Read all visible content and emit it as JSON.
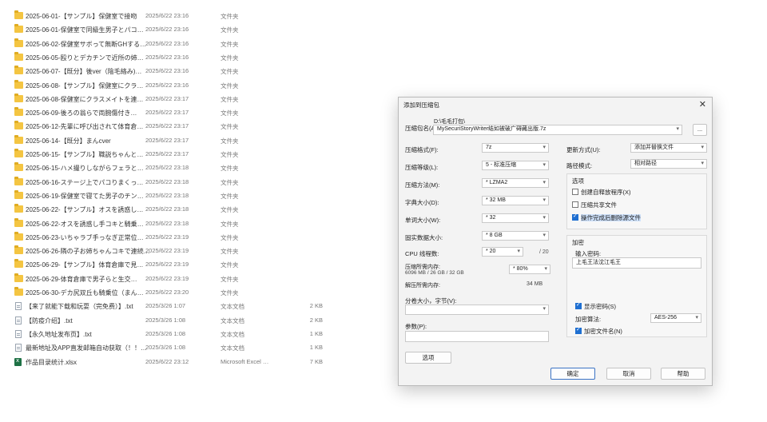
{
  "files": [
    {
      "name": "2025-06-01-【サンプル】保健室で接吻",
      "date": "2025/6/22 23:16",
      "type": "文件夹",
      "size": "",
      "icon": "folder-icon"
    },
    {
      "name": "2025-06-01-保健室で同級生男子とパコ…",
      "date": "2025/6/22 23:16",
      "type": "文件夹",
      "size": "",
      "icon": "folder-icon"
    },
    {
      "name": "2025-06-02-保健室サボって無断GHする…",
      "date": "2025/6/22 23:16",
      "type": "文件夹",
      "size": "",
      "icon": "folder-icon"
    },
    {
      "name": "2025-06-05-殴りとデカチンで近所の姉…",
      "date": "2025/6/22 23:16",
      "type": "文件夹",
      "size": "",
      "icon": "folder-icon"
    },
    {
      "name": "2025-06-07-【既分】後ver（陰毛絡み)…",
      "date": "2025/6/22 23:16",
      "type": "文件夹",
      "size": "",
      "icon": "folder-icon"
    },
    {
      "name": "2025-06-08-【サンプル】保健室にクラ…",
      "date": "2025/6/22 23:16",
      "type": "文件夹",
      "size": "",
      "icon": "folder-icon"
    },
    {
      "name": "2025-06-08-保健室にクラスメイトを連…",
      "date": "2025/6/22 23:17",
      "type": "文件夹",
      "size": "",
      "icon": "folder-icon"
    },
    {
      "name": "2025-06-09-後ろの翁らで両腕傷付き…",
      "date": "2025/6/22 23:17",
      "type": "文件夹",
      "size": "",
      "icon": "folder-icon"
    },
    {
      "name": "2025-06-12-先輩に呼び出されて体育倉…",
      "date": "2025/6/22 23:17",
      "type": "文件夹",
      "size": "",
      "icon": "folder-icon"
    },
    {
      "name": "2025-06-14-【既分】まんcver",
      "date": "2025/6/22 23:17",
      "type": "文件夹",
      "size": "",
      "icon": "folder-icon"
    },
    {
      "name": "2025-06-15-【サンプル】職説ちゃんと…",
      "date": "2025/6/22 23:17",
      "type": "文件夹",
      "size": "",
      "icon": "folder-icon"
    },
    {
      "name": "2025-06-15-ハメ撮りしながらフェラと…",
      "date": "2025/6/22 23:18",
      "type": "文件夹",
      "size": "",
      "icon": "folder-icon"
    },
    {
      "name": "2025-06-16-ステージ上でパコりまくっ…",
      "date": "2025/6/22 23:18",
      "type": "文件夹",
      "size": "",
      "icon": "folder-icon"
    },
    {
      "name": "2025-06-19-保健室で寝てた男子のチン…",
      "date": "2025/6/22 23:18",
      "type": "文件夹",
      "size": "",
      "icon": "folder-icon"
    },
    {
      "name": "2025-06-22-【サンプル】オスを誘惑し…",
      "date": "2025/6/22 23:18",
      "type": "文件夹",
      "size": "",
      "icon": "folder-icon"
    },
    {
      "name": "2025-06-22-オスを誘惑し手コキと騎乗…",
      "date": "2025/6/22 23:18",
      "type": "文件夹",
      "size": "",
      "icon": "folder-icon"
    },
    {
      "name": "2025-06-23-いちゃラブ手っなぎ正常位…",
      "date": "2025/6/22 23:19",
      "type": "文件夹",
      "size": "",
      "icon": "folder-icon"
    },
    {
      "name": "2025-06-26-隣の子お姉ちゃんコキで連続…",
      "date": "2025/6/22 23:19",
      "type": "文件夹",
      "size": "",
      "icon": "folder-icon"
    },
    {
      "name": "2025-06-29-【サンプル】体育倉庫で見…",
      "date": "2025/6/22 23:19",
      "type": "文件夹",
      "size": "",
      "icon": "folder-icon"
    },
    {
      "name": "2025-06-29-体育倉庫で男子らと生交…",
      "date": "2025/6/22 23:19",
      "type": "文件夹",
      "size": "",
      "icon": "folder-icon"
    },
    {
      "name": "2025-06-30-デカ尻双丘も騎乗位（まん…",
      "date": "2025/6/22 23:20",
      "type": "文件夹",
      "size": "",
      "icon": "folder-icon"
    },
    {
      "name": "【来了就能下载和玩耍（完免费）】.txt",
      "date": "2025/3/26 1:07",
      "type": "文本文档",
      "size": "2 KB",
      "icon": "text-file-icon"
    },
    {
      "name": "【防疫介绍】.txt",
      "date": "2025/3/26 1:08",
      "type": "文本文档",
      "size": "2 KB",
      "icon": "text-file-icon"
    },
    {
      "name": "【永久地址发布页】.txt",
      "date": "2025/3/26 1:08",
      "type": "文本文档",
      "size": "1 KB",
      "icon": "text-file-icon"
    },
    {
      "name": "最新地址及APP直发邮箱自动获取（！！…",
      "date": "2025/3/26 1:08",
      "type": "文本文档",
      "size": "1 KB",
      "icon": "text-file-icon"
    },
    {
      "name": "作品目录统计.xlsx",
      "date": "2025/6/22 23:12",
      "type": "Microsoft Excel …",
      "size": "7 KB",
      "icon": "excel-file-icon"
    }
  ],
  "dialog": {
    "title": "添加到压缩包",
    "close": "✕",
    "archive_name_label": "压缩包名(A)",
    "archive_path_top": "D:\\毛毛打包\\",
    "archive_path": "MySecuriStoryWriter结如被破广碍藏出版.7z",
    "browse_label": "...",
    "format_label": "压缩格式(F):",
    "format_value": "7z",
    "level_label": "压缩等级(L):",
    "level_value": "5 - 标准压缩",
    "method_label": "压缩方法(M):",
    "method_value": "* LZMA2",
    "dict_label": "字典大小(D):",
    "dict_value": "* 32 MB",
    "word_label": "单词大小(W):",
    "word_value": "* 32",
    "solid_label": "固实数据大小:",
    "solid_value": "* 8 GB",
    "cpu_label": "CPU 线程数:",
    "cpu_value": "* 20",
    "cpu_total": "/ 20",
    "mem_label": "压缩所需内存:",
    "mem_detail": "6096 MB / 26 GB / 32 GB",
    "mem_pct": "* 80%",
    "decomp_label": "解压所需内存:",
    "decomp_value": "34 MB",
    "split_label": "分卷大小，字节(V):",
    "split_value": "",
    "params_label": "参数(P):",
    "params_value": "",
    "options_button": "选项",
    "update_label": "更新方式(U):",
    "update_value": "添加并替换文件",
    "path_label": "路径模式:",
    "path_value": "相对路径",
    "options_group": "选项",
    "opt_sfx": "创建自释放程序(X)",
    "opt_shared": "压缩共享文件",
    "opt_delete": "操作完成后删除源文件",
    "encrypt_group": "加密",
    "password_label": "输入密码:",
    "password_value": "上毛王法沈江毛王",
    "show_password": "显示密码(S)",
    "enc_method_label": "加密算法:",
    "enc_method_value": "AES-256",
    "encrypt_names": "加密文件名(N)",
    "ok": "确定",
    "cancel": "取消",
    "help": "帮助"
  }
}
